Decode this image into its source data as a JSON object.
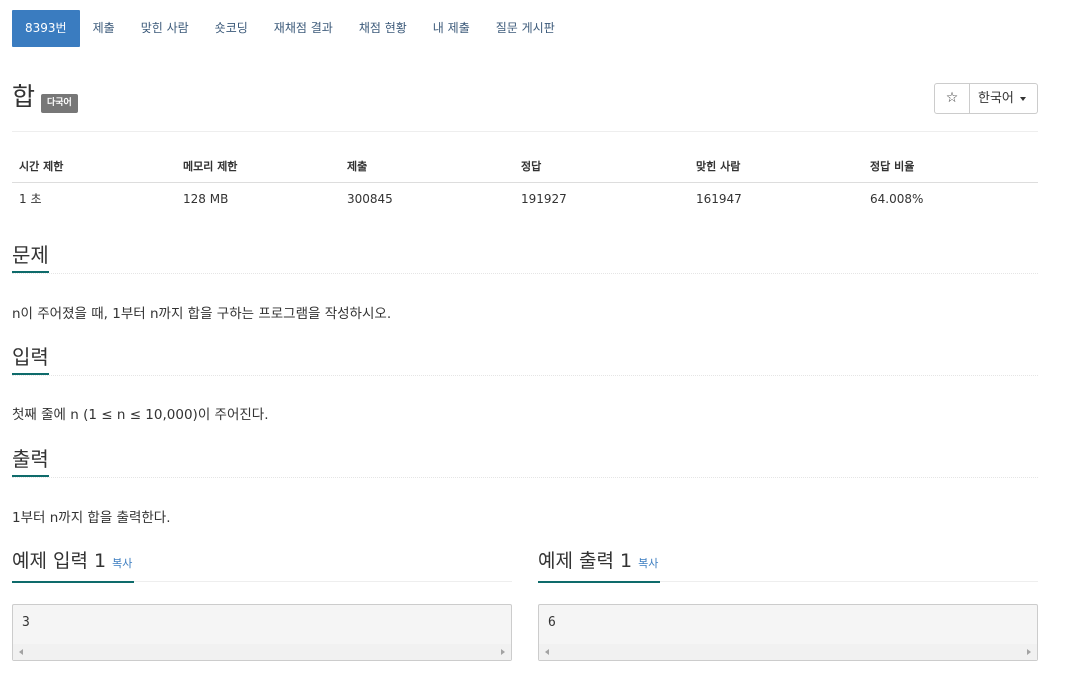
{
  "tabs": [
    {
      "label": "8393번",
      "active": true
    },
    {
      "label": "제출"
    },
    {
      "label": "맞힌 사람"
    },
    {
      "label": "숏코딩"
    },
    {
      "label": "재채점 결과"
    },
    {
      "label": "채점 현황"
    },
    {
      "label": "내 제출"
    },
    {
      "label": "질문 게시판"
    }
  ],
  "title": "합",
  "title_badge": "다국어",
  "star_icon": "☆",
  "language_button": "한국어",
  "info": {
    "headers": [
      "시간 제한",
      "메모리 제한",
      "제출",
      "정답",
      "맞힌 사람",
      "정답 비율"
    ],
    "values": [
      "1 초",
      "128 MB",
      "300845",
      "191927",
      "161947",
      "64.008%"
    ]
  },
  "problem": {
    "heading": "문제",
    "text": "n이 주어졌을 때, 1부터 n까지 합을 구하는 프로그램을 작성하시오."
  },
  "input": {
    "heading": "입력",
    "text": "첫째 줄에 n (1 ≤ n ≤ 10,000)이 주어진다."
  },
  "output": {
    "heading": "출력",
    "text": "1부터 n까지 합을 출력한다."
  },
  "sample_input": {
    "heading": "예제 입력 1",
    "copy": "복사",
    "value": "3"
  },
  "sample_output": {
    "heading": "예제 출력 1",
    "copy": "복사",
    "value": "6"
  }
}
